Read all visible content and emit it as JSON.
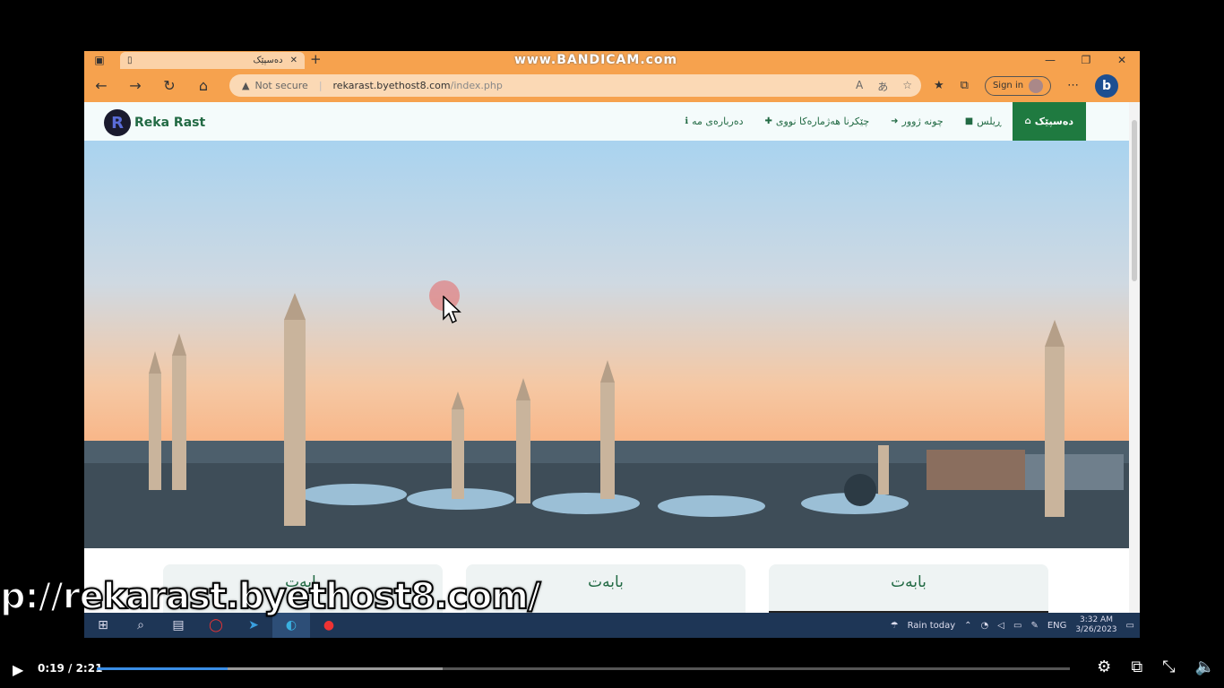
{
  "browser": {
    "tab_title": "دەسپێک",
    "watermark": "www.BANDICAM.com",
    "not_secure": "Not secure",
    "url_host": "rekarast.byethost8.com",
    "url_path": "/index.php",
    "sign_in": "Sign in"
  },
  "site": {
    "brand": "Reka Rast",
    "logo_letter": "R",
    "menu": [
      {
        "label": "دەسپێک",
        "icon": "home-icon",
        "glyph": "⌂"
      },
      {
        "label": "ڕیلس",
        "icon": "video-icon",
        "glyph": "■"
      },
      {
        "label": "چونە ژوور",
        "icon": "sign-in-icon",
        "glyph": "➜"
      },
      {
        "label": "چێکرنا هەژمارەکا نووی",
        "icon": "user-plus-icon",
        "glyph": "✚"
      },
      {
        "label": "دەربارەی مە",
        "icon": "info-icon",
        "glyph": "ℹ"
      }
    ],
    "cards": [
      {
        "title": "بابەت"
      },
      {
        "title": "بابەت"
      },
      {
        "title": "بابەت"
      }
    ]
  },
  "overlay": {
    "caption": "p://rekarast.byethost8.com/"
  },
  "taskbar": {
    "weather": "Rain today",
    "lang": "ENG",
    "time": "3:32 AM",
    "date": "3/26/2023"
  },
  "player": {
    "time": "0:19 / 2:21",
    "progress_fraction": 0.134,
    "buffered_fraction": 0.355
  }
}
